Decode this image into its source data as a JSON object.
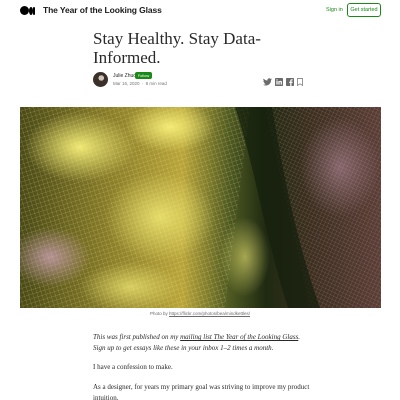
{
  "header": {
    "publication_title": "The Year of the Looking Glass",
    "sign_in_label": "Sign in",
    "get_started_label": "Get started"
  },
  "article": {
    "title": "Stay Healthy. Stay Data-Informed.",
    "author": {
      "name": "Julie Zhuo",
      "follow_label": "Follow",
      "date": "Mar 16, 2020",
      "separator": "·",
      "read_time": "8 min read"
    },
    "share_icons": [
      "twitter-icon",
      "linkedin-icon",
      "facebook-icon",
      "bookmark-icon"
    ],
    "hero": {
      "caption_prefix": "Photo by",
      "caption_link": "https://flickr.com/photos/bea/mindkettles/"
    },
    "intro": {
      "text_before_link": "This was first published on my ",
      "link_text": "mailing list The Year of the Looking Glass",
      "text_after_link": ". Sign up to get essays like these in your inbox 1–2 times a month."
    },
    "paragraphs": [
      "I have a confession to make.",
      "As a designer, for years my primary goal was striving to improve my product intuition."
    ]
  },
  "colors": {
    "accent": "#1a8917",
    "text": "#292929",
    "muted": "#757575"
  }
}
